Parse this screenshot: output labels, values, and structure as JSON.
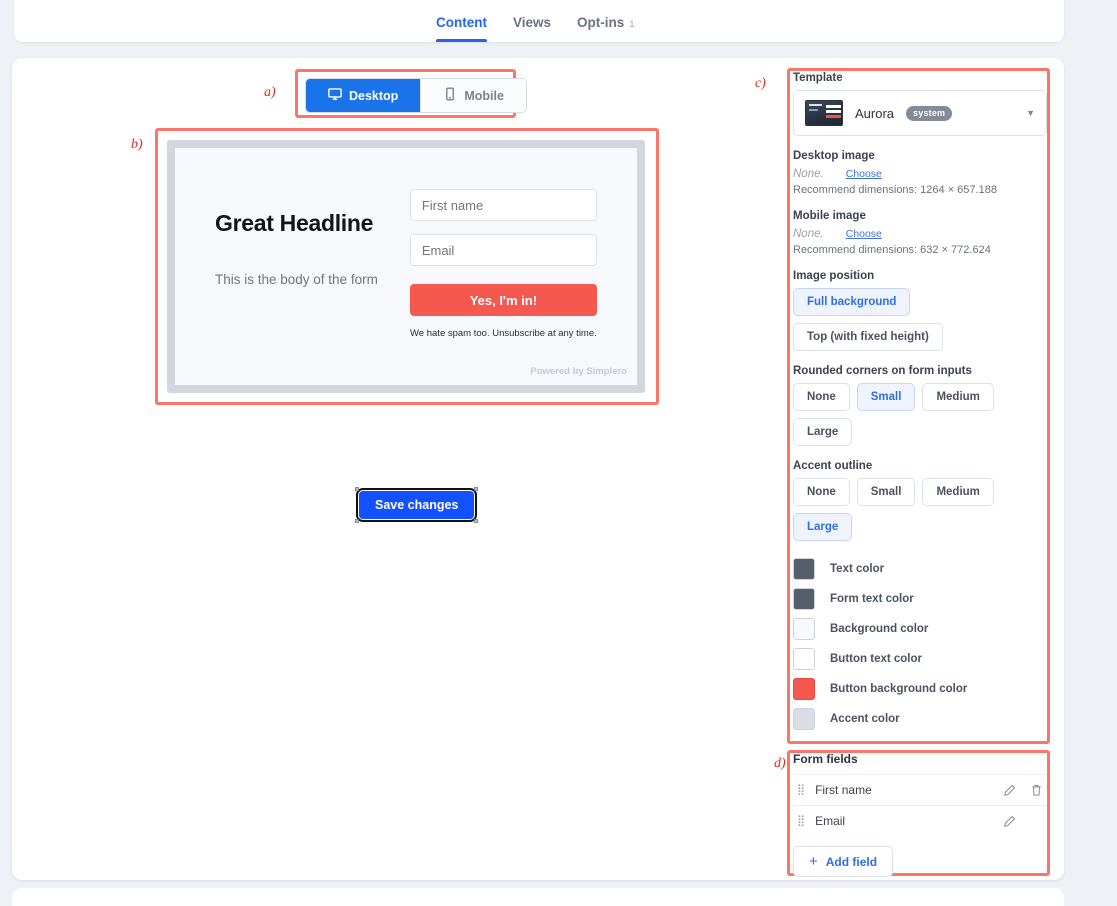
{
  "tabs": [
    {
      "label": "Content",
      "active": true,
      "count": ""
    },
    {
      "label": "Views",
      "active": false,
      "count": ""
    },
    {
      "label": "Opt-ins",
      "active": false,
      "count": "1"
    }
  ],
  "annotations": {
    "a": "a)",
    "b": "b)",
    "c": "c)",
    "d": "d)"
  },
  "device_toggle": {
    "desktop": {
      "label": "Desktop",
      "icon": "monitor-icon",
      "active": true
    },
    "mobile": {
      "label": "Mobile",
      "icon": "phone-icon",
      "active": false
    }
  },
  "preview": {
    "headline": "Great Headline",
    "body": "This is the body of the form",
    "inputs": [
      {
        "placeholder": "First name"
      },
      {
        "placeholder": "Email"
      }
    ],
    "submit_label": "Yes, I'm in!",
    "spam_notice": "We hate spam too. Unsubscribe at any time.",
    "powered_by": "Powered by Simplero"
  },
  "save": {
    "label": "Save changes"
  },
  "settings": {
    "template": {
      "label": "Template",
      "name": "Aurora",
      "badge": "system",
      "caret_icon": "chevron-down-icon"
    },
    "desktop_image": {
      "label": "Desktop image",
      "value": "None.",
      "choose_label": "Choose",
      "recommend": "Recommend dimensions: 1264 × 657.188"
    },
    "mobile_image": {
      "label": "Mobile image",
      "value": "None.",
      "choose_label": "Choose",
      "recommend": "Recommend dimensions: 632 × 772.624"
    },
    "image_position": {
      "label": "Image position",
      "options": [
        {
          "label": "Full background",
          "selected": true
        },
        {
          "label": "Top (with fixed height)",
          "selected": false
        }
      ]
    },
    "rounded_corners": {
      "label": "Rounded corners on form inputs",
      "options": [
        {
          "label": "None",
          "selected": false
        },
        {
          "label": "Small",
          "selected": true
        },
        {
          "label": "Medium",
          "selected": false
        },
        {
          "label": "Large",
          "selected": false
        }
      ]
    },
    "accent_outline": {
      "label": "Accent outline",
      "options": [
        {
          "label": "None",
          "selected": false
        },
        {
          "label": "Small",
          "selected": false
        },
        {
          "label": "Medium",
          "selected": false
        },
        {
          "label": "Large",
          "selected": true
        }
      ]
    },
    "colors": [
      {
        "label": "Text color",
        "hex": "#575e6b"
      },
      {
        "label": "Form text color",
        "hex": "#575e6b"
      },
      {
        "label": "Background color",
        "hex": "#f7f9fc"
      },
      {
        "label": "Button text color",
        "hex": "#ffffff"
      },
      {
        "label": "Button background color",
        "hex": "#f4584f"
      },
      {
        "label": "Accent color",
        "hex": "#dadee4"
      }
    ]
  },
  "form_fields": {
    "title": "Form fields",
    "rows": [
      {
        "name": "First name",
        "has_edit": true,
        "has_delete": true
      },
      {
        "name": "Email",
        "has_edit": true,
        "has_delete": false
      }
    ],
    "add_label": "Add field"
  }
}
